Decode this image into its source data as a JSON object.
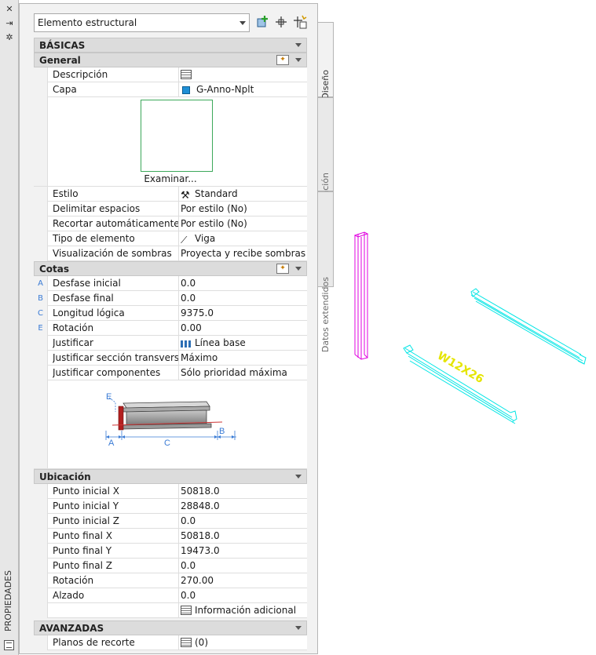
{
  "left_bar": {
    "title": "PROPIEDADES",
    "icons": [
      "close-icon",
      "auto-hide-icon",
      "settings-icon",
      "properties-window-icon"
    ]
  },
  "toolbar": {
    "object_type": "Elemento estructural",
    "buttons": [
      "add-selection-icon",
      "select-objects-icon",
      "quick-select-icon"
    ]
  },
  "side_tabs": [
    "Diseño",
    "Visualización",
    "Datos extendidos"
  ],
  "basic": {
    "header": "BÁSICAS",
    "general": {
      "header": "General",
      "rows": [
        {
          "label": "Descripción",
          "value": "",
          "icon": "table-icon"
        },
        {
          "label": "Capa",
          "value": "G-Anno-Nplt",
          "icon": "layer-color-icon",
          "color": "#1f8fd6"
        }
      ],
      "preview_button": "Examinar...",
      "rows2": [
        {
          "label": "Estilo",
          "value": "Standard",
          "icon": "style-icon"
        },
        {
          "label": "Delimitar espacios",
          "value": "Por estilo (No)"
        },
        {
          "label": "Recortar automáticamente",
          "value": "Por estilo (No)"
        },
        {
          "label": "Tipo de elemento",
          "value": "Viga",
          "icon": "beam-icon"
        },
        {
          "label": "Visualización de sombras",
          "value": "Proyecta y recibe sombras"
        }
      ]
    },
    "dimensions": {
      "header": "Cotas",
      "rows": [
        {
          "key": "A",
          "label": "Desfase inicial",
          "value": "0.0"
        },
        {
          "key": "B",
          "label": "Desfase final",
          "value": "0.0"
        },
        {
          "key": "C",
          "label": "Longitud lógica",
          "value": "9375.0"
        },
        {
          "key": "E",
          "label": "Rotación",
          "value": "0.00"
        },
        {
          "key": "",
          "label": "Justificar",
          "value": "Línea base",
          "icon": "justify-icon"
        },
        {
          "key": "",
          "label": "Justificar sección transversal",
          "value": "Máximo"
        },
        {
          "key": "",
          "label": "Justificar componentes",
          "value": "Sólo prioridad máxima"
        }
      ],
      "diagram_labels": [
        "E",
        "A",
        "C",
        "B"
      ]
    }
  },
  "location": {
    "header": "Ubicación",
    "rows": [
      {
        "label": "Punto inicial X",
        "value": "50818.0"
      },
      {
        "label": "Punto inicial Y",
        "value": "28848.0"
      },
      {
        "label": "Punto inicial Z",
        "value": "0.0"
      },
      {
        "label": "Punto final X",
        "value": "50818.0"
      },
      {
        "label": "Punto final Y",
        "value": "19473.0"
      },
      {
        "label": "Punto final Z",
        "value": "0.0"
      },
      {
        "label": "Rotación",
        "value": "270.00"
      },
      {
        "label": "Alzado",
        "value": "0.0"
      },
      {
        "label": "",
        "value": "Información adicional",
        "icon": "table-icon"
      }
    ]
  },
  "advanced": {
    "header": "AVANZADAS",
    "rows": [
      {
        "label": "Planos de recorte",
        "value": "(0)",
        "icon": "table-icon"
      }
    ]
  },
  "drawing": {
    "beam_label": "W12X26",
    "column_color": "#e000e0",
    "beam_color": "#00e5e5",
    "label_color": "#e5e500"
  }
}
